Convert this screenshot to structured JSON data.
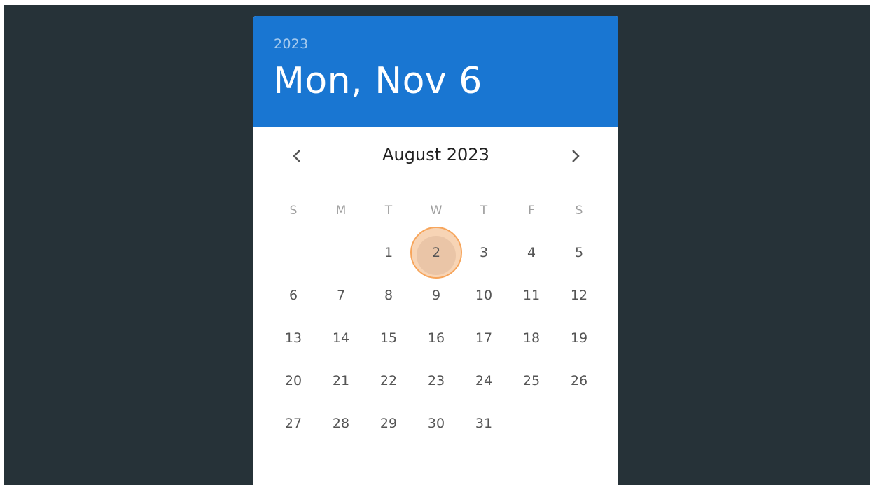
{
  "header": {
    "year": "2023",
    "date": "Mon, Nov 6"
  },
  "nav": {
    "month_label": "August 2023",
    "prev_icon": "chevron-left-icon",
    "next_icon": "chevron-right-icon"
  },
  "weekdays": [
    "S",
    "M",
    "T",
    "W",
    "T",
    "F",
    "S"
  ],
  "weeks": [
    [
      "",
      "",
      "1",
      "2",
      "3",
      "4",
      "5"
    ],
    [
      "6",
      "7",
      "8",
      "9",
      "10",
      "11",
      "12"
    ],
    [
      "13",
      "14",
      "15",
      "16",
      "17",
      "18",
      "19"
    ],
    [
      "20",
      "21",
      "22",
      "23",
      "24",
      "25",
      "26"
    ],
    [
      "27",
      "28",
      "29",
      "30",
      "31",
      "",
      ""
    ]
  ],
  "highlighted_day": "2",
  "colors": {
    "background": "#263238",
    "header": "#1976d2",
    "highlight": "#f7a55b"
  }
}
